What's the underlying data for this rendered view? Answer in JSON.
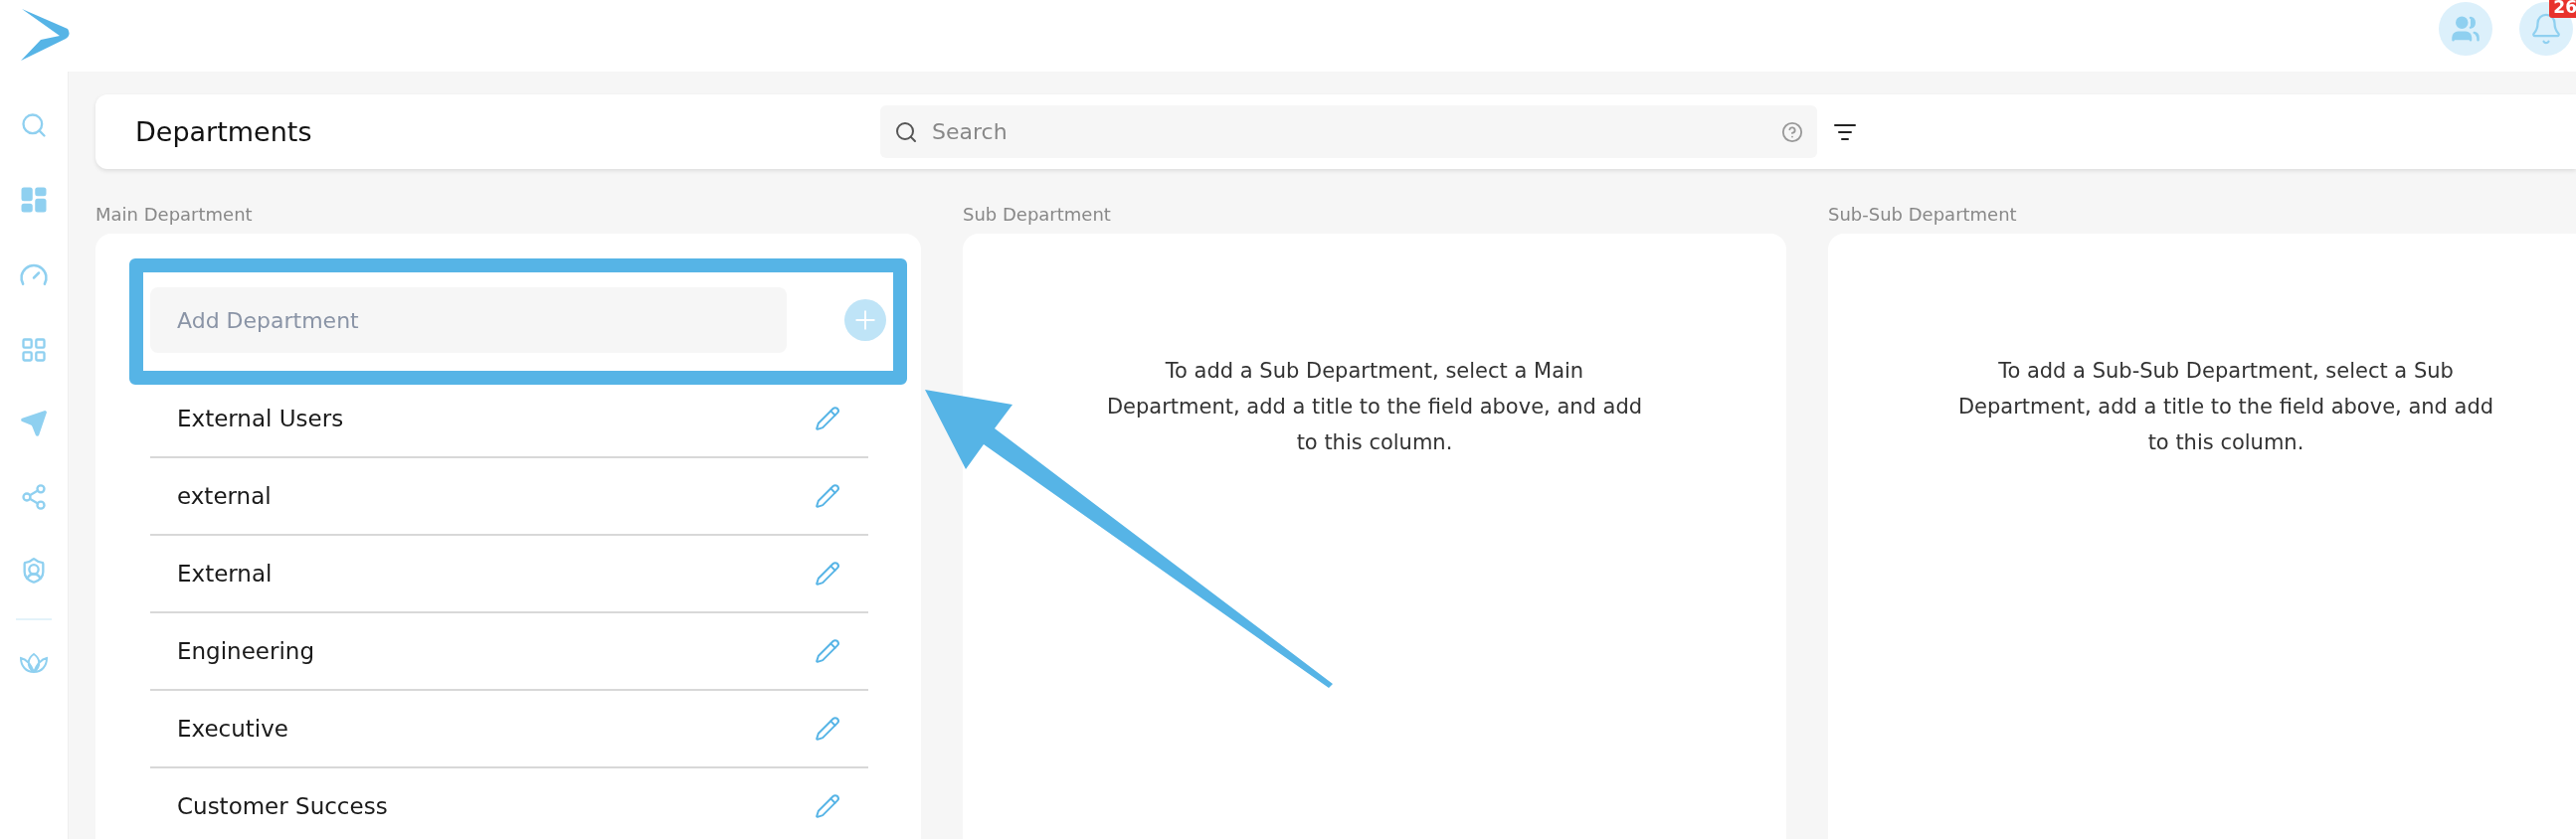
{
  "topbar": {
    "notification_count": "26"
  },
  "header": {
    "title": "Departments",
    "search": {
      "placeholder": "Search"
    }
  },
  "columns": [
    {
      "label": "Main Department",
      "kind": "list",
      "add_field": {
        "placeholder": "Add Department"
      },
      "items": [
        "External Users",
        "external",
        "External",
        "Engineering",
        "Executive",
        "Customer Success"
      ]
    },
    {
      "label": "Sub Department",
      "kind": "empty",
      "message": "To add a Sub Department, select a Main Department, add a title to the field above, and add to this column."
    },
    {
      "label": "Sub-Sub Department",
      "kind": "empty",
      "message": "To add a Sub-Sub Department, select a Sub Department, add a title to the field above, and add to this column."
    }
  ],
  "annotations": {
    "highlight_box": true,
    "arrow": true
  }
}
